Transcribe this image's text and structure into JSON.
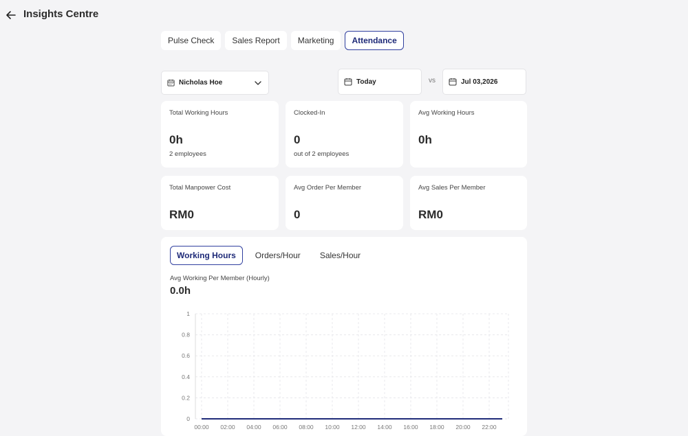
{
  "header": {
    "title": "Insights Centre"
  },
  "tabs": [
    {
      "label": "Pulse Check",
      "active": false
    },
    {
      "label": "Sales Report",
      "active": false
    },
    {
      "label": "Marketing",
      "active": false
    },
    {
      "label": "Attendance",
      "active": true
    }
  ],
  "filters": {
    "employee": "Nicholas Hoe",
    "date_from": "Today",
    "vs_label": "vs",
    "date_to": "Jul 03,2026"
  },
  "stats": [
    {
      "label": "Total Working Hours",
      "value": "0h",
      "sub": "2 employees"
    },
    {
      "label": "Clocked-In",
      "value": "0",
      "sub": "out of 2 employees"
    },
    {
      "label": "Avg Working Hours",
      "value": "0h",
      "sub": ""
    },
    {
      "label": "Total Manpower Cost",
      "value": "RM0",
      "sub": ""
    },
    {
      "label": "Avg Order Per Member",
      "value": "0",
      "sub": ""
    },
    {
      "label": "Avg Sales Per Member",
      "value": "RM0",
      "sub": ""
    }
  ],
  "chart_tabs": [
    {
      "label": "Working Hours",
      "active": true
    },
    {
      "label": "Orders/Hour",
      "active": false
    },
    {
      "label": "Sales/Hour",
      "active": false
    }
  ],
  "chart_summary": {
    "label": "Avg Working Per Member (Hourly)",
    "value": "0.0h"
  },
  "colors": {
    "accent": "#2f3e9e",
    "line": "#1e2a78",
    "grid": "#e8e8ec"
  },
  "chart_data": {
    "type": "line",
    "x": [
      "00:00",
      "01:00",
      "02:00",
      "03:00",
      "04:00",
      "05:00",
      "06:00",
      "07:00",
      "08:00",
      "09:00",
      "10:00",
      "11:00",
      "12:00",
      "13:00",
      "14:00",
      "15:00",
      "16:00",
      "17:00",
      "18:00",
      "19:00",
      "20:00",
      "21:00",
      "22:00",
      "23:00"
    ],
    "x_tick_labels": [
      "00:00",
      "02:00",
      "04:00",
      "06:00",
      "08:00",
      "10:00",
      "12:00",
      "14:00",
      "16:00",
      "18:00",
      "20:00",
      "22:00"
    ],
    "series": [
      {
        "values": [
          0,
          0,
          0,
          0,
          0,
          0,
          0,
          0,
          0,
          0,
          0,
          0,
          0,
          0,
          0,
          0,
          0,
          0,
          0,
          0,
          0,
          0,
          0,
          0
        ]
      }
    ],
    "y_ticks": [
      0,
      0.2,
      0.4,
      0.6,
      0.8,
      1
    ],
    "ylim": [
      0,
      1
    ],
    "grid": true,
    "title": "",
    "xlabel": "",
    "ylabel": ""
  }
}
